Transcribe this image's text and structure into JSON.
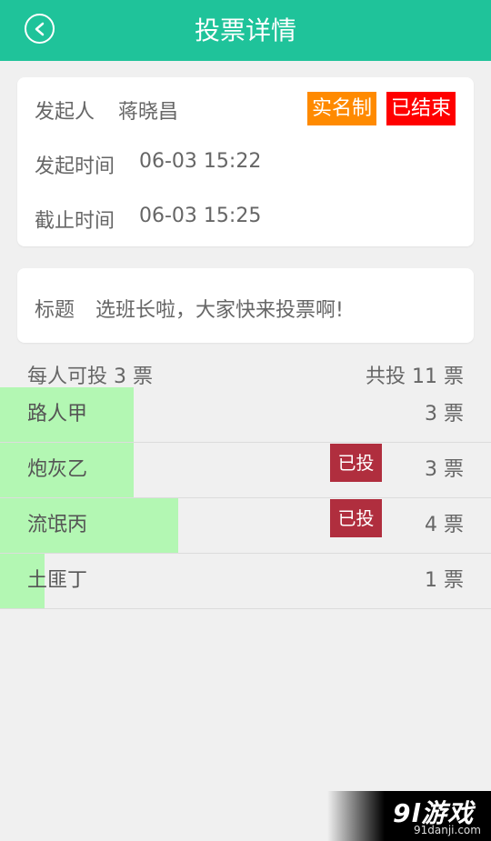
{
  "header": {
    "title": "投票详情"
  },
  "info": {
    "initiator_label": "发起人",
    "initiator_name": "蒋晓昌",
    "badge_real_name": "实名制",
    "badge_ended": "已结束",
    "start_label": "发起时间",
    "start_value": "06-03 15:22",
    "end_label": "截止时间",
    "end_value": "06-03 15:25"
  },
  "subject": {
    "label": "标题",
    "value": "选班长啦，大家快来投票啊!"
  },
  "summary": {
    "per_person": "每人可投 3 票",
    "total": "共投 11 票"
  },
  "options": [
    {
      "name": "路人甲",
      "count_text": "3 票",
      "votes": 3,
      "voted": false
    },
    {
      "name": "炮灰乙",
      "count_text": "3 票",
      "votes": 3,
      "voted": true,
      "voted_label": "已投"
    },
    {
      "name": "流氓丙",
      "count_text": "4 票",
      "votes": 4,
      "voted": true,
      "voted_label": "已投"
    },
    {
      "name": "土匪丁",
      "count_text": "1 票",
      "votes": 1,
      "voted": false
    }
  ],
  "watermark": {
    "logo": "9l游戏",
    "url": "91danji.com"
  },
  "colors": {
    "accent": "#1fc39a",
    "bar": "#b3f7b3",
    "badge_real": "#ff8a00",
    "badge_ended": "#ff0000",
    "voted": "#b02e3e"
  }
}
